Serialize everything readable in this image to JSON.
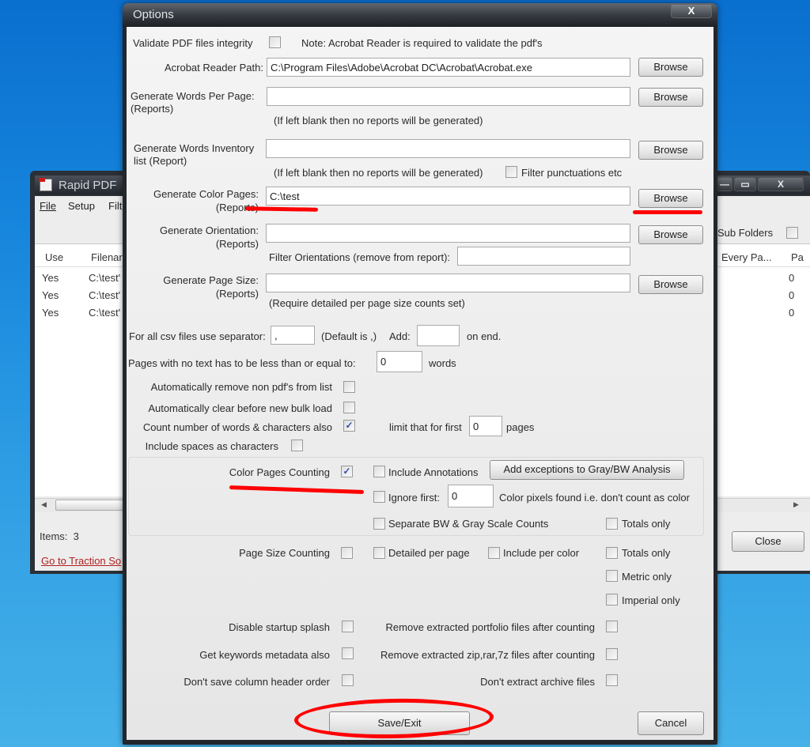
{
  "background_window": {
    "title": "Rapid PDF",
    "menu": [
      "File",
      "Setup",
      "Filt"
    ],
    "columns_left": [
      "Use",
      "Filenar"
    ],
    "columns_right": [
      "Every Pa...",
      "Pa"
    ],
    "rows": [
      {
        "use": "Yes",
        "filename": "C:\\test'",
        "pages": "0"
      },
      {
        "use": "Yes",
        "filename": "C:\\test'",
        "pages": "0"
      },
      {
        "use": "Yes",
        "filename": "C:\\test'",
        "pages": "0"
      }
    ],
    "sub_folders_label": "Sub Folders",
    "items_label": "Items:",
    "items_count": "3",
    "link": "Go to Traction So",
    "close_label": "Close",
    "caption_buttons": {
      "minimize": "—",
      "maximize": "▭",
      "close": "X"
    }
  },
  "dialog": {
    "title": "Options",
    "close_glyph": "X",
    "validate": {
      "label": "Validate PDF files integrity",
      "checked": false,
      "note": "Note: Acrobat Reader is required to validate the pdf's"
    },
    "acrobat_path": {
      "label": "Acrobat Reader Path:",
      "value": "C:\\Program Files\\Adobe\\Acrobat DC\\Acrobat\\Acrobat.exe",
      "button": "Browse"
    },
    "words_per_page": {
      "label1": "Generate Words Per Page:",
      "label2": "(Reports)",
      "value": "",
      "button": "Browse",
      "hint": "(If left blank then no reports will be generated)"
    },
    "words_inventory": {
      "label1": "Generate Words Inventory",
      "label2": "list (Report)",
      "value": "",
      "button": "Browse",
      "hint": "(If left blank then no reports will be generated)",
      "filter_label": "Filter punctuations etc",
      "filter_checked": false
    },
    "color_pages": {
      "label1": "Generate Color Pages:",
      "label2": "(Reports)",
      "value": "C:\\test",
      "button": "Browse"
    },
    "orientation": {
      "label1": "Generate Orientation:",
      "label2": "(Reports)",
      "value": "",
      "button": "Browse",
      "filter_label": "Filter Orientations (remove from report):",
      "filter_value": ""
    },
    "page_size": {
      "label1": "Generate Page Size:",
      "label2": "(Reports)",
      "value": "",
      "button": "Browse",
      "hint": "(Require detailed per page size counts set)"
    },
    "csv": {
      "label": "For all csv files use separator:",
      "separator": ",",
      "default_note": "(Default is ,)",
      "add_label": "Add:",
      "add_value": "",
      "end_label": "on end."
    },
    "no_text": {
      "label": "Pages with no text has to be less than or equal to:",
      "value": "0",
      "unit": "words"
    },
    "auto_remove": {
      "label": "Automatically remove non pdf's from list",
      "checked": false
    },
    "auto_clear": {
      "label": "Automatically clear before new bulk load",
      "checked": false
    },
    "count_words": {
      "label": "Count number of words & characters also",
      "checked": true,
      "limit_label": "limit that for first",
      "limit_value": "0",
      "limit_unit": "pages"
    },
    "include_spaces": {
      "label": "Include spaces as characters",
      "checked": false
    },
    "color_counting": {
      "label": "Color Pages Counting",
      "checked": true,
      "include_annotations": {
        "label": "Include Annotations",
        "checked": false
      },
      "exceptions_button": "Add exceptions to Gray/BW Analysis",
      "ignore_first": {
        "label": "Ignore first:",
        "checked": false,
        "value": "0",
        "suffix": "Color pixels found i.e. don't count as color"
      },
      "separate_bw": {
        "label": "Separate BW & Gray Scale Counts",
        "checked": false
      },
      "totals_only": {
        "label": "Totals only",
        "checked": false
      }
    },
    "page_size_counting": {
      "label": "Page Size Counting",
      "checked": false,
      "detailed": {
        "label": "Detailed per page",
        "checked": false
      },
      "per_color": {
        "label": "Include per color",
        "checked": false
      },
      "totals_only": {
        "label": "Totals only",
        "checked": false
      },
      "metric_only": {
        "label": "Metric only",
        "checked": false
      },
      "imperial_only": {
        "label": "Imperial only",
        "checked": false
      }
    },
    "misc": {
      "disable_splash": {
        "label": "Disable startup splash",
        "checked": false
      },
      "keywords": {
        "label": "Get keywords metadata also",
        "checked": false
      },
      "header_order": {
        "label": "Don't save column header order",
        "checked": false
      },
      "remove_portfolio": {
        "label": "Remove extracted portfolio files after counting",
        "checked": false
      },
      "remove_zip": {
        "label": "Remove extracted zip,rar,7z files after counting",
        "checked": false
      },
      "no_extract": {
        "label": "Don't extract archive files",
        "checked": false
      }
    },
    "save_button": "Save/Exit",
    "cancel_button": "Cancel"
  },
  "annotation_color": "#ff0000",
  "check_glyph": "✓"
}
